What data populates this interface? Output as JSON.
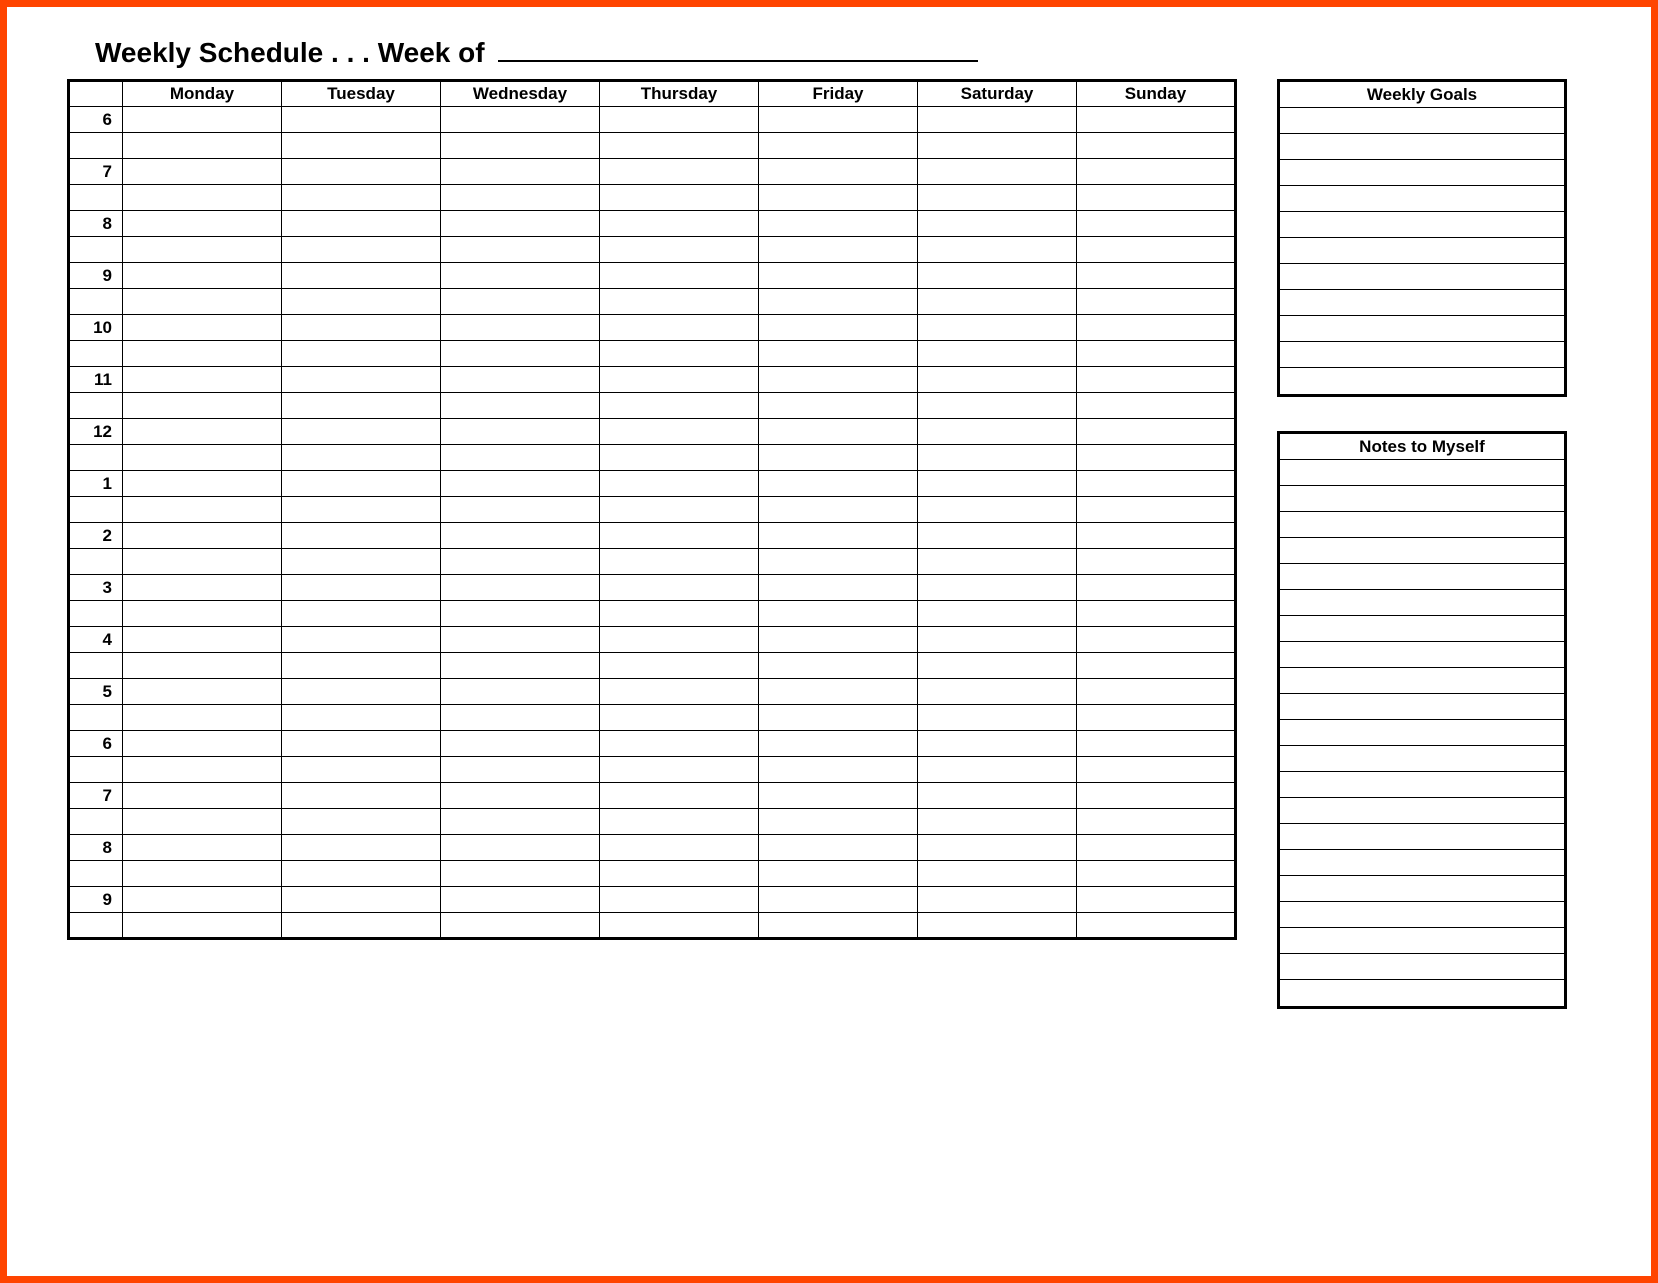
{
  "title_prefix": "Weekly Schedule . . . Week of",
  "days": [
    "Monday",
    "Tuesday",
    "Wednesday",
    "Thursday",
    "Friday",
    "Saturday",
    "Sunday"
  ],
  "hours": [
    "6",
    "7",
    "8",
    "9",
    "10",
    "11",
    "12",
    "1",
    "2",
    "3",
    "4",
    "5",
    "6",
    "7",
    "8",
    "9"
  ],
  "rows_per_hour": 2,
  "goals": {
    "title": "Weekly Goals",
    "rows": 11
  },
  "notes": {
    "title": "Notes to Myself",
    "rows": 21
  }
}
